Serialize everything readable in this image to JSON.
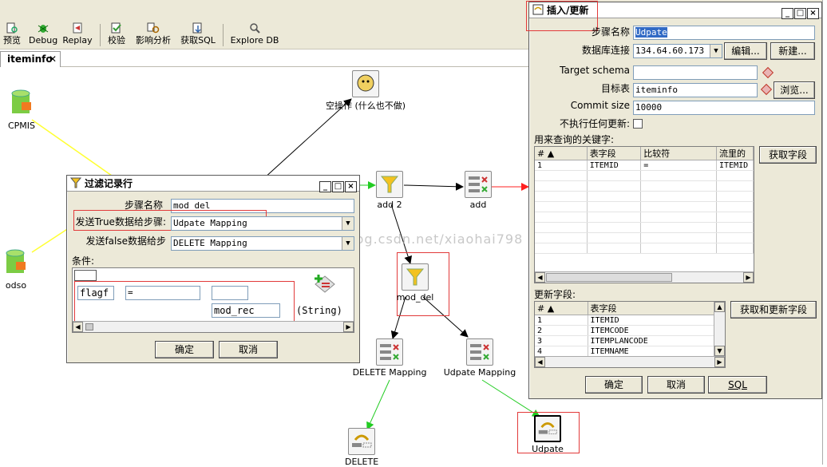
{
  "toolbar": {
    "buttons": [
      {
        "label": "预览",
        "icon": "preview-icon"
      },
      {
        "label": "Debug",
        "icon": "bug-icon"
      },
      {
        "label": "Replay",
        "icon": "replay-icon"
      },
      {
        "label": "校验",
        "icon": "verify-icon"
      },
      {
        "label": "影响分析",
        "icon": "impact-analysis-icon"
      },
      {
        "label": "获取SQL",
        "icon": "get-sql-icon"
      },
      {
        "label": "Explore DB",
        "icon": "explore-db-icon"
      }
    ]
  },
  "tab": {
    "label": "iteminfo",
    "close": "✕"
  },
  "canvas": {
    "watermark": "http://blog.csdn.net/xiaohai798",
    "nodes": {
      "cpmis": "CPMIS",
      "odso": "odso",
      "dummy": "空操作 (什么也不做)",
      "add2": "add 2",
      "add": "add",
      "mod_del": "mod_del",
      "delete_mapping": "DELETE Mapping",
      "udpate_mapping": "Udpate Mapping",
      "delete_out": "DELETE",
      "udpate": "Udpate"
    }
  },
  "filter_dialog": {
    "title": "过滤记录行",
    "step_name_label": "步骤名称",
    "step_name": "mod_del",
    "true_label": "发送True数据给步骤:",
    "true_value": "Udpate Mapping",
    "false_label": "发送false数据给步",
    "false_value": "DELETE Mapping",
    "condition_label": "条件:",
    "cond_field": "flagf",
    "cond_op": "=",
    "cond_value": "mod_rec",
    "cond_type": "(String)",
    "ok": "确定",
    "cancel": "取消"
  },
  "insert_dialog": {
    "title": "插入/更新",
    "step_name_label": "步骤名称",
    "step_name": "Udpate",
    "db_label": "数据库连接",
    "db_value": "134.64.60.173",
    "edit": "编辑...",
    "new": "新建...",
    "schema_label": "Target schema",
    "schema_value": "",
    "table_label": "目标表",
    "table_value": "iteminfo",
    "browse": "浏览...",
    "commit_label": "Commit size",
    "commit_value": "10000",
    "no_update_label": "不执行任何更新:",
    "key_label": "用来查询的关键字:",
    "key_columns": [
      "#",
      "表字段",
      "比较符",
      "流里的"
    ],
    "key_rows": [
      [
        "1",
        "ITEMID",
        "=",
        "ITEMID"
      ]
    ],
    "get_fields": "获取字段",
    "update_label": "更新字段:",
    "update_columns": [
      "#",
      "表字段"
    ],
    "update_rows": [
      [
        "1",
        "ITEMID"
      ],
      [
        "2",
        "ITEMCODE"
      ],
      [
        "3",
        "ITEMPLANCODE"
      ],
      [
        "4",
        "ITEMNAME"
      ]
    ],
    "get_update_fields": "获取和更新字段",
    "ok": "确定",
    "cancel": "取消",
    "sql": "SQL"
  },
  "colors": {
    "hop_normal": "#000000",
    "hop_true": "#22cc22",
    "hop_error": "#ff2020",
    "hop_yellow": "#ffff33",
    "highlight": "#e23a3a"
  }
}
